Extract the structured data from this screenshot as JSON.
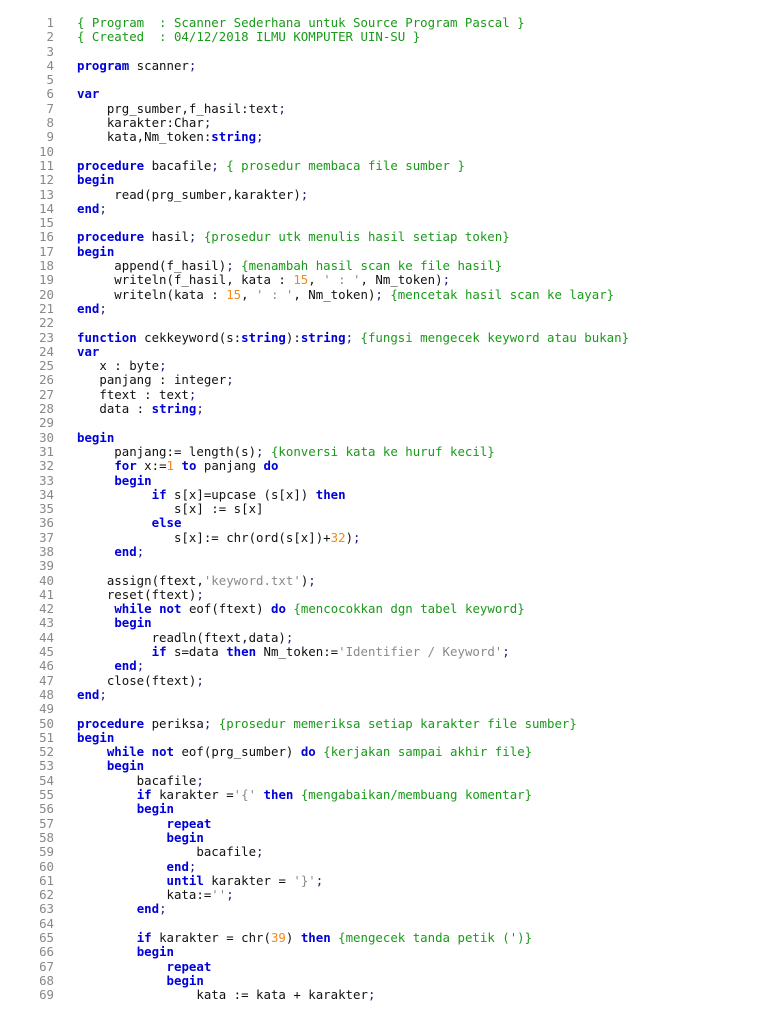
{
  "colors": {
    "keyword": "#0000d8",
    "comment": "#1a9a1a",
    "number": "#f08a1c",
    "string": "#8a8a8a",
    "text": "#111111",
    "line_number": "#888888"
  },
  "lines": [
    [
      [
        "c",
        "{ Program  : Scanner Sederhana untuk Source Program Pascal }"
      ]
    ],
    [
      [
        "c",
        "{ Created  : 04/12/2018 ILMU KOMPUTER UIN-SU }"
      ]
    ],
    [],
    [
      [
        "k",
        "program"
      ],
      [
        "p",
        " scanner"
      ],
      [
        "o",
        ";"
      ]
    ],
    [],
    [
      [
        "k",
        "var"
      ]
    ],
    [
      [
        "p",
        "    prg_sumber,f_hasil:text"
      ],
      [
        "o",
        ";"
      ]
    ],
    [
      [
        "p",
        "    karakter:Char"
      ],
      [
        "o",
        ";"
      ]
    ],
    [
      [
        "p",
        "    kata,Nm_token:"
      ],
      [
        "k",
        "string"
      ],
      [
        "o",
        ";"
      ]
    ],
    [],
    [
      [
        "k",
        "procedure"
      ],
      [
        "p",
        " bacafile"
      ],
      [
        "o",
        "; "
      ],
      [
        "c",
        "{ prosedur membaca file sumber }"
      ]
    ],
    [
      [
        "k",
        "begin"
      ]
    ],
    [
      [
        "p",
        "     read(prg_sumber,karakter)"
      ],
      [
        "o",
        ";"
      ]
    ],
    [
      [
        "k",
        "end"
      ],
      [
        "o",
        ";"
      ]
    ],
    [],
    [
      [
        "k",
        "procedure"
      ],
      [
        "p",
        " hasil"
      ],
      [
        "o",
        "; "
      ],
      [
        "c",
        "{prosedur utk menulis hasil setiap token}"
      ]
    ],
    [
      [
        "k",
        "begin"
      ]
    ],
    [
      [
        "p",
        "     append(f_hasil)"
      ],
      [
        "o",
        "; "
      ],
      [
        "c",
        "{menambah hasil scan ke file hasil}"
      ]
    ],
    [
      [
        "p",
        "     writeln(f_hasil, kata : "
      ],
      [
        "n",
        "15"
      ],
      [
        "p",
        ", "
      ],
      [
        "s",
        "' : '"
      ],
      [
        "p",
        ", Nm_token)"
      ],
      [
        "o",
        ";"
      ]
    ],
    [
      [
        "p",
        "     writeln(kata : "
      ],
      [
        "n",
        "15"
      ],
      [
        "p",
        ", "
      ],
      [
        "s",
        "' : '"
      ],
      [
        "p",
        ", Nm_token)"
      ],
      [
        "o",
        "; "
      ],
      [
        "c",
        "{mencetak hasil scan ke layar}"
      ]
    ],
    [
      [
        "k",
        "end"
      ],
      [
        "o",
        ";"
      ]
    ],
    [],
    [
      [
        "k",
        "function"
      ],
      [
        "p",
        " cekkeyword(s:"
      ],
      [
        "k",
        "string"
      ],
      [
        "p",
        "):"
      ],
      [
        "k",
        "string"
      ],
      [
        "o",
        "; "
      ],
      [
        "c",
        "{fungsi mengecek keyword atau bukan}"
      ]
    ],
    [
      [
        "k",
        "var"
      ]
    ],
    [
      [
        "p",
        "   x : byte"
      ],
      [
        "o",
        ";"
      ]
    ],
    [
      [
        "p",
        "   panjang : integer"
      ],
      [
        "o",
        ";"
      ]
    ],
    [
      [
        "p",
        "   ftext : text"
      ],
      [
        "o",
        ";"
      ]
    ],
    [
      [
        "p",
        "   data : "
      ],
      [
        "k",
        "string"
      ],
      [
        "o",
        ";"
      ]
    ],
    [],
    [
      [
        "k",
        "begin"
      ]
    ],
    [
      [
        "p",
        "     panjang:= length(s)"
      ],
      [
        "o",
        "; "
      ],
      [
        "c",
        "{konversi kata ke huruf kecil}"
      ]
    ],
    [
      [
        "p",
        "     "
      ],
      [
        "k",
        "for"
      ],
      [
        "p",
        " x:="
      ],
      [
        "n",
        "1"
      ],
      [
        "p",
        " "
      ],
      [
        "k",
        "to"
      ],
      [
        "p",
        " panjang "
      ],
      [
        "k",
        "do"
      ]
    ],
    [
      [
        "p",
        "     "
      ],
      [
        "k",
        "begin"
      ]
    ],
    [
      [
        "p",
        "          "
      ],
      [
        "k",
        "if"
      ],
      [
        "p",
        " s[x]=upcase (s[x]) "
      ],
      [
        "k",
        "then"
      ]
    ],
    [
      [
        "p",
        "             s[x] := s[x]"
      ]
    ],
    [
      [
        "p",
        "          "
      ],
      [
        "k",
        "else"
      ]
    ],
    [
      [
        "p",
        "             s[x]:= chr(ord(s[x])+"
      ],
      [
        "n",
        "32"
      ],
      [
        "p",
        ")"
      ],
      [
        "o",
        ";"
      ]
    ],
    [
      [
        "p",
        "     "
      ],
      [
        "k",
        "end"
      ],
      [
        "o",
        ";"
      ]
    ],
    [],
    [
      [
        "p",
        "    assign(ftext,"
      ],
      [
        "s",
        "'keyword.txt'"
      ],
      [
        "p",
        ")"
      ],
      [
        "o",
        ";"
      ]
    ],
    [
      [
        "p",
        "    reset(ftext)"
      ],
      [
        "o",
        ";"
      ]
    ],
    [
      [
        "p",
        "     "
      ],
      [
        "k",
        "while"
      ],
      [
        "p",
        " "
      ],
      [
        "k",
        "not"
      ],
      [
        "p",
        " eof(ftext) "
      ],
      [
        "k",
        "do"
      ],
      [
        "p",
        " "
      ],
      [
        "c",
        "{mencocokkan dgn tabel keyword}"
      ]
    ],
    [
      [
        "p",
        "     "
      ],
      [
        "k",
        "begin"
      ]
    ],
    [
      [
        "p",
        "          readln(ftext,data)"
      ],
      [
        "o",
        ";"
      ]
    ],
    [
      [
        "p",
        "          "
      ],
      [
        "k",
        "if"
      ],
      [
        "p",
        " s=data "
      ],
      [
        "k",
        "then"
      ],
      [
        "p",
        " Nm_token:="
      ],
      [
        "s",
        "'Identifier / Keyword'"
      ],
      [
        "o",
        ";"
      ]
    ],
    [
      [
        "p",
        "     "
      ],
      [
        "k",
        "end"
      ],
      [
        "o",
        ";"
      ]
    ],
    [
      [
        "p",
        "    close(ftext)"
      ],
      [
        "o",
        ";"
      ]
    ],
    [
      [
        "k",
        "end"
      ],
      [
        "o",
        ";"
      ]
    ],
    [],
    [
      [
        "k",
        "procedure"
      ],
      [
        "p",
        " periksa"
      ],
      [
        "o",
        "; "
      ],
      [
        "c",
        "{prosedur memeriksa setiap karakter file sumber}"
      ]
    ],
    [
      [
        "k",
        "begin"
      ]
    ],
    [
      [
        "p",
        "    "
      ],
      [
        "k",
        "while"
      ],
      [
        "p",
        " "
      ],
      [
        "k",
        "not"
      ],
      [
        "p",
        " eof(prg_sumber) "
      ],
      [
        "k",
        "do"
      ],
      [
        "p",
        " "
      ],
      [
        "c",
        "{kerjakan sampai akhir file}"
      ]
    ],
    [
      [
        "p",
        "    "
      ],
      [
        "k",
        "begin"
      ]
    ],
    [
      [
        "p",
        "        bacafile"
      ],
      [
        "o",
        ";"
      ]
    ],
    [
      [
        "p",
        "        "
      ],
      [
        "k",
        "if"
      ],
      [
        "p",
        " karakter ="
      ],
      [
        "s",
        "'{'"
      ],
      [
        "p",
        " "
      ],
      [
        "k",
        "then"
      ],
      [
        "p",
        " "
      ],
      [
        "c",
        "{mengabaikan/membuang komentar}"
      ]
    ],
    [
      [
        "p",
        "        "
      ],
      [
        "k",
        "begin"
      ]
    ],
    [
      [
        "p",
        "            "
      ],
      [
        "k",
        "repeat"
      ]
    ],
    [
      [
        "p",
        "            "
      ],
      [
        "k",
        "begin"
      ]
    ],
    [
      [
        "p",
        "                bacafile"
      ],
      [
        "o",
        ";"
      ]
    ],
    [
      [
        "p",
        "            "
      ],
      [
        "k",
        "end"
      ],
      [
        "o",
        ";"
      ]
    ],
    [
      [
        "p",
        "            "
      ],
      [
        "k",
        "until"
      ],
      [
        "p",
        " karakter = "
      ],
      [
        "s",
        "'}'"
      ],
      [
        "o",
        ";"
      ]
    ],
    [
      [
        "p",
        "            kata:="
      ],
      [
        "s",
        "''"
      ],
      [
        "o",
        ";"
      ]
    ],
    [
      [
        "p",
        "        "
      ],
      [
        "k",
        "end"
      ],
      [
        "o",
        ";"
      ]
    ],
    [],
    [
      [
        "p",
        "        "
      ],
      [
        "k",
        "if"
      ],
      [
        "p",
        " karakter = chr("
      ],
      [
        "n",
        "39"
      ],
      [
        "p",
        ") "
      ],
      [
        "k",
        "then"
      ],
      [
        "p",
        " "
      ],
      [
        "c",
        "{mengecek tanda petik (')}"
      ]
    ],
    [
      [
        "p",
        "        "
      ],
      [
        "k",
        "begin"
      ]
    ],
    [
      [
        "p",
        "            "
      ],
      [
        "k",
        "repeat"
      ]
    ],
    [
      [
        "p",
        "            "
      ],
      [
        "k",
        "begin"
      ]
    ],
    [
      [
        "p",
        "                kata := kata + karakter"
      ],
      [
        "o",
        ";"
      ]
    ]
  ]
}
